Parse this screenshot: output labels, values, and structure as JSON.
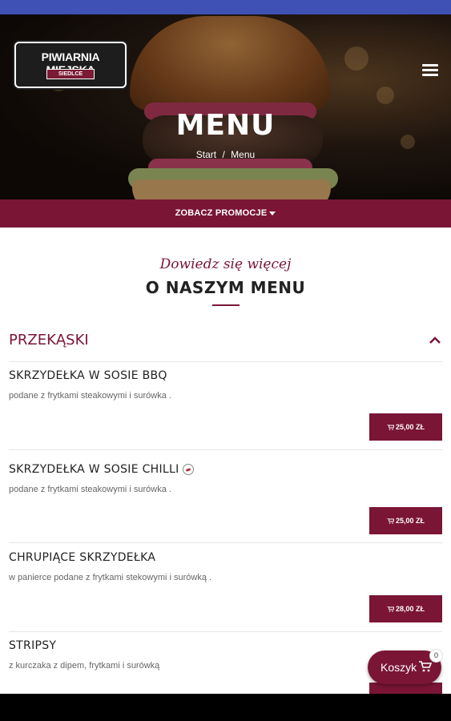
{
  "header": {
    "logo_main": "PIWIARNIA MIEJSKA",
    "logo_sub": "SIEDLCE",
    "title": "MENU",
    "breadcrumb": [
      "Start",
      "/",
      "Menu"
    ]
  },
  "promo": {
    "label": "ZOBACZ PROMOCJE"
  },
  "intro": {
    "script_text": "Dowiedz się więcej",
    "title": "O NASZYM MENU"
  },
  "category": {
    "label": "PRZEKĄSKI"
  },
  "items": [
    {
      "name": "SKRZYDEŁKA W SOSIE BBQ",
      "desc": "podane z frytkami steakowymi i surówka .",
      "price": "25,00 ZŁ"
    },
    {
      "name": "SKRZYDEŁKA W SOSIE CHILLI",
      "desc": "podane z frytkami steakowymi i surówka .",
      "price": "25,00 ZŁ"
    },
    {
      "name": "CHRUPIĄCE SKRZYDEŁKA",
      "desc": "w panierce podane z frytkami stekowymi i surówką .",
      "price": "28,00 ZŁ"
    },
    {
      "name": "STRIPSY",
      "desc": "z kurczaka z dipem, frytkami i surówką",
      "price": ""
    }
  ],
  "cart": {
    "label": "Koszyk",
    "count": "0"
  },
  "colors": {
    "accent": "#7a1536",
    "statusbar": "#3f51b5"
  }
}
